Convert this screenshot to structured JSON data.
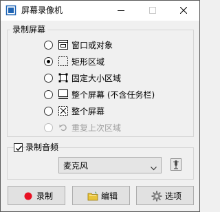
{
  "window": {
    "title": "屏幕录像机"
  },
  "screen_group": {
    "title": "录制屏幕",
    "options": [
      {
        "label": "窗口或对象",
        "icon": "window-icon",
        "selected": false,
        "enabled": true
      },
      {
        "label": "矩形区域",
        "icon": "dashed-rect-icon",
        "selected": true,
        "enabled": true
      },
      {
        "label": "固定大小区域",
        "icon": "fixed-region-icon",
        "selected": false,
        "enabled": true
      },
      {
        "label": "整个屏幕 (不含任务栏)",
        "icon": "screen-no-taskbar-icon",
        "selected": false,
        "enabled": true
      },
      {
        "label": "整个屏幕",
        "icon": "fullscreen-icon",
        "selected": false,
        "enabled": true
      },
      {
        "label": "重复上次区域",
        "icon": "repeat-icon",
        "selected": false,
        "enabled": false
      }
    ]
  },
  "audio_group": {
    "label": "录制音频",
    "checked": true,
    "device": "麦克风"
  },
  "buttons": {
    "record": "录制",
    "edit": "编辑",
    "options": "选项"
  },
  "colors": {
    "record_dot": "#e81123",
    "edit_folder": "#e8c43a",
    "disabled": "#a0a0a0"
  }
}
